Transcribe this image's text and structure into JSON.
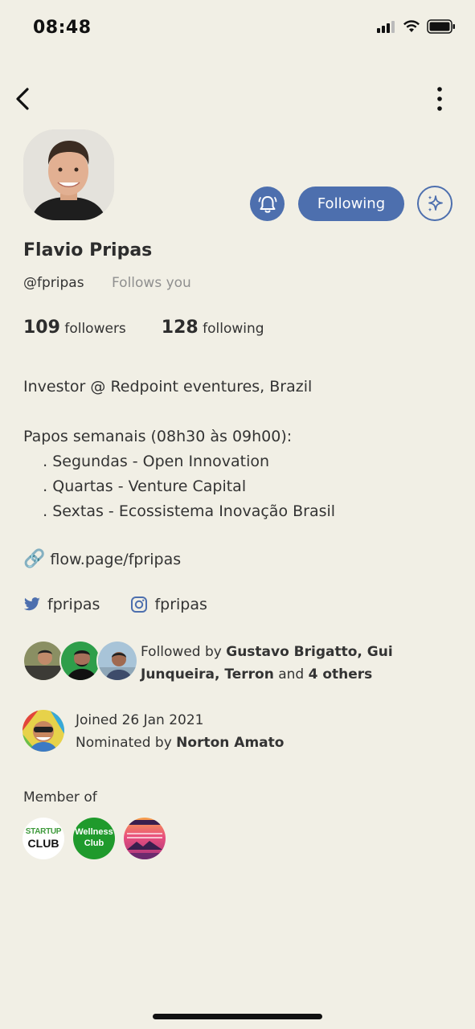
{
  "status_bar": {
    "time": "08:48"
  },
  "profile": {
    "name": "Flavio Pripas",
    "handle": "@fpripas",
    "follows_you": "Follows you",
    "followers_count": "109",
    "followers_label": "followers",
    "following_count": "128",
    "following_label": "following",
    "following_button": "Following",
    "bio": "Investor @ Redpoint eventures, Brazil\n\nPapos semanais (08h30 às 09h00):\n    . Segundas - Open Innovation\n    . Quartas - Venture Capital\n    . Sextas - Ecossistema Inovação Brasil",
    "link_emoji": "🔗",
    "link": "flow.page/fpripas",
    "twitter": "fpripas",
    "instagram": "fpripas"
  },
  "followed_by": {
    "prefix": "Followed by ",
    "names": "Gustavo Brigatto, Gui Junqueira, Terron",
    "and": " and ",
    "others": "4 others"
  },
  "joined": {
    "date_text": "Joined 26 Jan 2021",
    "nominated_prefix": "Nominated by ",
    "nominator": "Norton Amato"
  },
  "member_of": {
    "label": "Member of",
    "clubs": [
      {
        "line1": "STARTUP",
        "line2": "CLUB"
      },
      {
        "line1": "Wellness",
        "line2": "Club"
      },
      {
        "line1": "",
        "line2": ""
      }
    ]
  },
  "colors": {
    "accent": "#4d6fae",
    "background": "#f1efe5"
  },
  "icons": [
    "back-icon",
    "more-icon",
    "bell-icon",
    "sparkle-icon",
    "link-icon",
    "twitter-icon",
    "instagram-icon"
  ]
}
